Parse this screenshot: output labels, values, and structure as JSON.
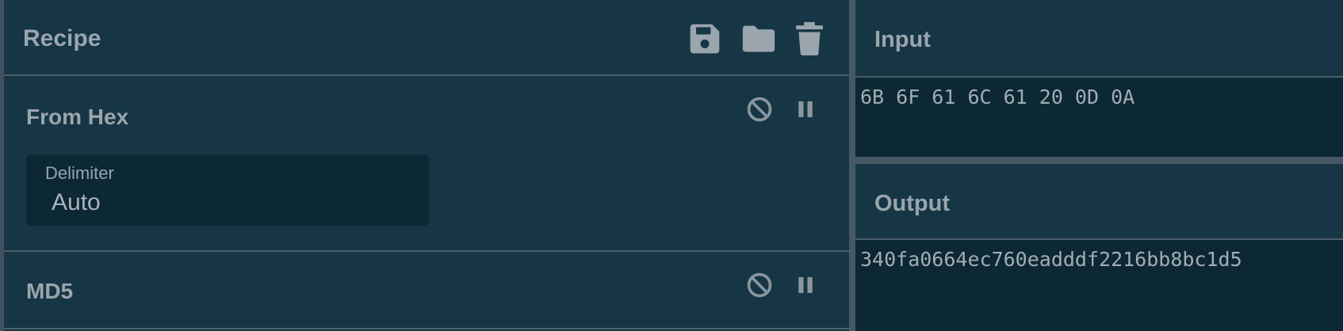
{
  "recipe": {
    "title": "Recipe",
    "icons": [
      "save-icon",
      "folder-icon",
      "trash-icon"
    ],
    "operations": [
      {
        "name": "From Hex",
        "icons": [
          "disable-icon",
          "pause-icon"
        ],
        "args": [
          {
            "label": "Delimiter",
            "value": "Auto"
          }
        ]
      },
      {
        "name": "MD5",
        "icons": [
          "disable-icon",
          "pause-icon"
        ]
      }
    ]
  },
  "input": {
    "title": "Input",
    "value": "6B 6F 61 6C 61 20 0D 0A"
  },
  "output": {
    "title": "Output",
    "value": "340fa0664ec760eadddf2216bb8bc1d5"
  },
  "colors": {
    "background": "#163645",
    "field_background": "#0c2835",
    "divider": "#455a66",
    "text": "#9aa5ad"
  }
}
